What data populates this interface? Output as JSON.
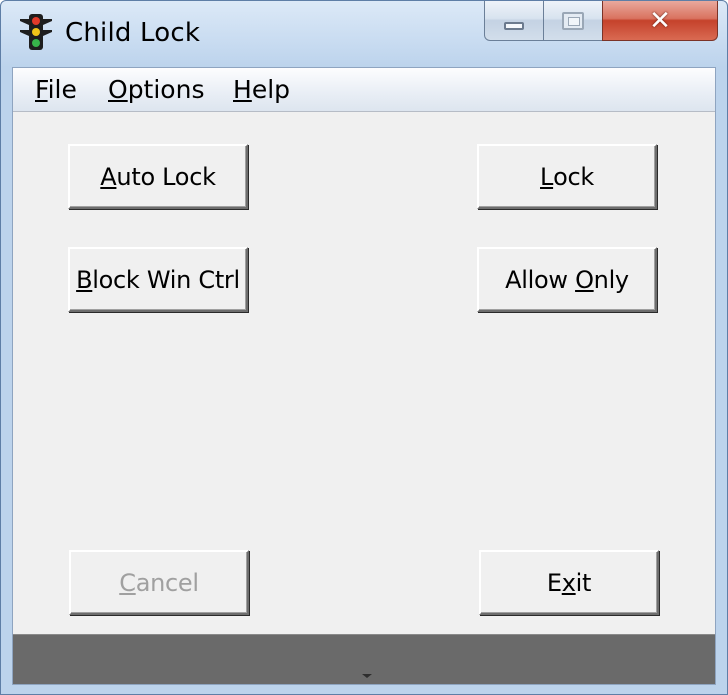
{
  "window": {
    "title": "Child Lock",
    "icon": "traffic-light-icon"
  },
  "caption_buttons": {
    "minimize_icon": "minimize-icon",
    "maximize_icon": "maximize-icon",
    "close_glyph": "✕"
  },
  "menu": {
    "file": {
      "accel": "F",
      "rest": "ile"
    },
    "options": {
      "accel": "O",
      "rest": "ptions"
    },
    "help": {
      "accel": "H",
      "rest": "elp"
    }
  },
  "buttons": {
    "auto_lock": {
      "accel": "A",
      "rest": "uto Lock"
    },
    "lock": {
      "accel": "L",
      "rest": "ock"
    },
    "block_win_ctrl": {
      "accel": "B",
      "rest": "lock Win Ctrl"
    },
    "allow_only": {
      "pre": "Allow ",
      "accel": "O",
      "rest": "nly"
    },
    "cancel": {
      "accel": "C",
      "rest": "ancel",
      "disabled": true
    },
    "exit": {
      "pre": "E",
      "accel": "x",
      "rest": "it"
    }
  },
  "colors": {
    "close_red": "#c5422b",
    "face": "#f0f0f0",
    "status_bar": "#6a6a6a",
    "disabled_text": "#a0a0a0"
  }
}
